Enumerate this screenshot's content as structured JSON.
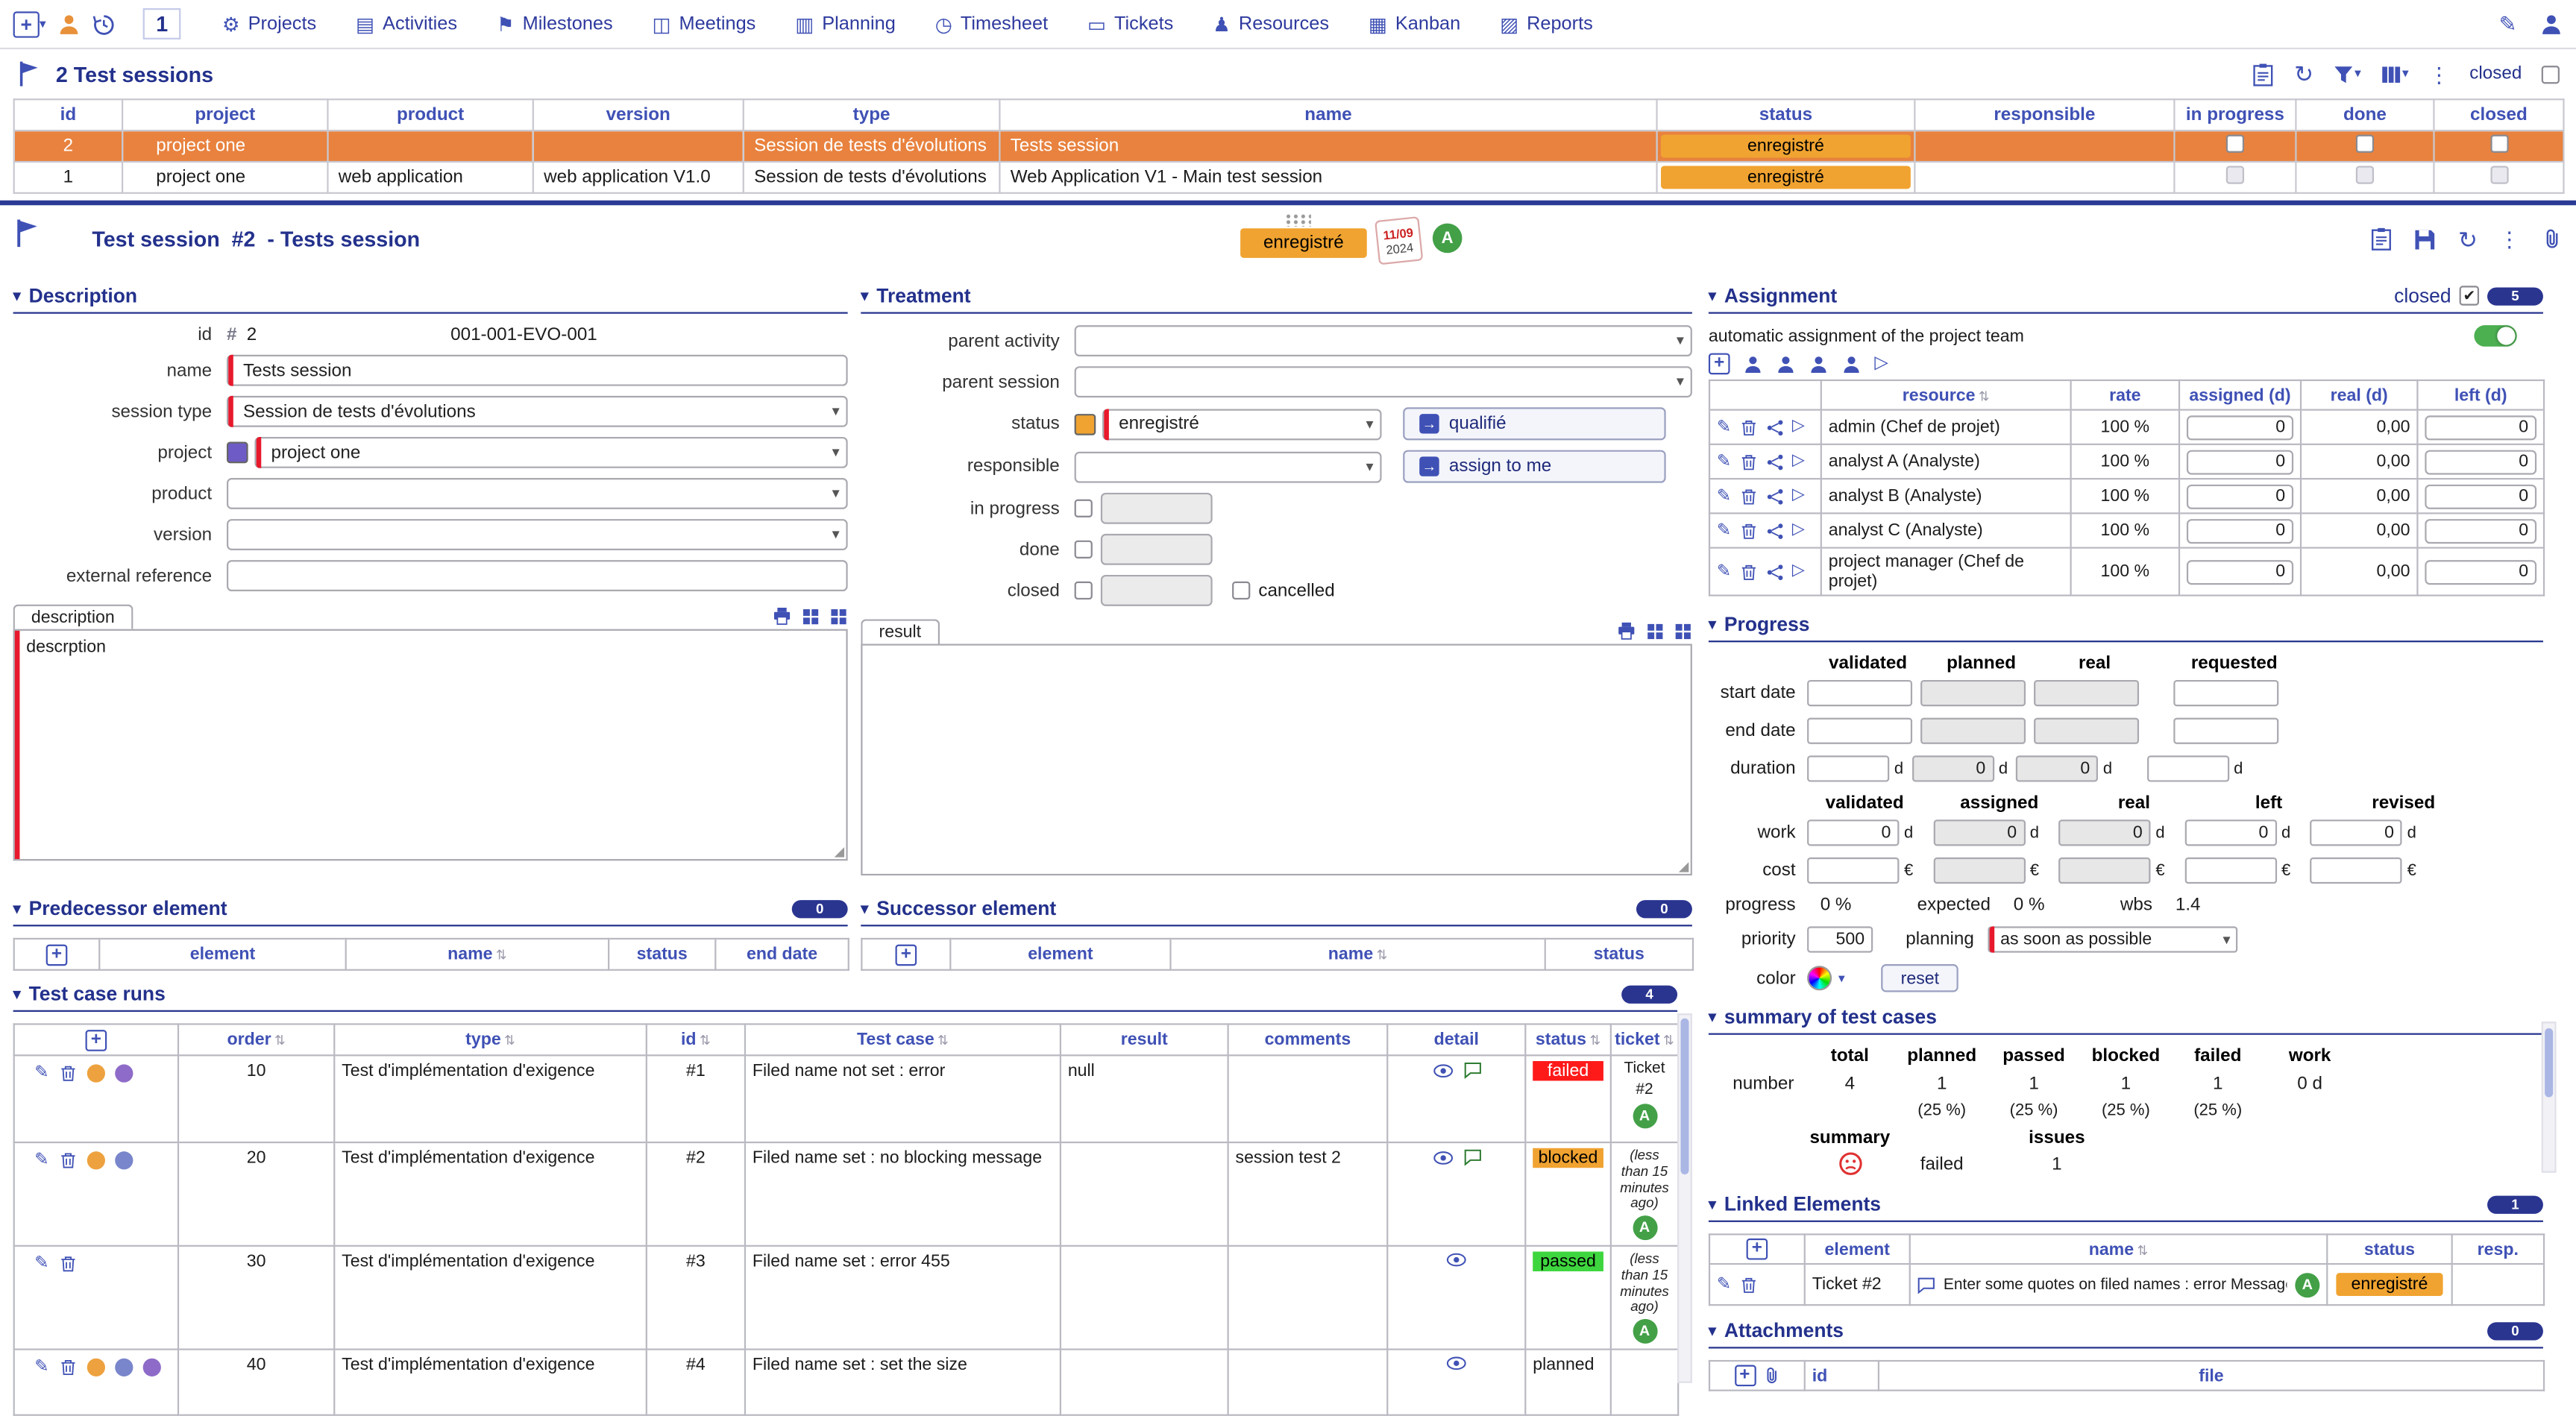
{
  "icons": {
    "plus": "+",
    "caret": "▾",
    "kebab": "⋮",
    "refresh": "↻",
    "pencil": "✎",
    "sort": "⇅",
    "play": "▷",
    "hash": "#",
    "check": "✔",
    "arrow": "→"
  },
  "status_colors": {
    "failed": {
      "bg": "#ff1a1a",
      "fg": "#ffffff"
    },
    "blocked": {
      "bg": "#f0a330",
      "fg": "#000000"
    },
    "passed": {
      "bg": "#3ed63e",
      "fg": "#000000"
    },
    "planned": {
      "bg": "#ffffff",
      "fg": "#000000"
    },
    "enregistré": {
      "bg": "#f0a330",
      "fg": "#000000"
    }
  },
  "topbar": {
    "count_badge": "1",
    "menu": [
      {
        "icon": "⚙",
        "label": "Projects"
      },
      {
        "icon": "▤",
        "label": "Activities"
      },
      {
        "icon": "⚑",
        "label": "Milestones"
      },
      {
        "icon": "◫",
        "label": "Meetings"
      },
      {
        "icon": "▥",
        "label": "Planning"
      },
      {
        "icon": "◷",
        "label": "Timesheet"
      },
      {
        "icon": "▭",
        "label": "Tickets"
      },
      {
        "icon": "♟",
        "label": "Resources"
      },
      {
        "icon": "▦",
        "label": "Kanban"
      },
      {
        "icon": "▨",
        "label": "Reports"
      }
    ]
  },
  "list": {
    "title": "2 Test sessions",
    "closed_label": "closed",
    "columns": {
      "id": "id",
      "project": "project",
      "product": "product",
      "version": "version",
      "type": "type",
      "name": "name",
      "status": "status",
      "responsible": "responsible",
      "in_progress": "in progress",
      "done": "done",
      "closed": "closed"
    },
    "rows": [
      {
        "id": "2",
        "project": "project one",
        "product": "",
        "version": "",
        "type": "Session de tests d'évolutions",
        "name": "Tests session",
        "status": "enregistré"
      },
      {
        "id": "1",
        "project": "project one",
        "product": "web application",
        "version": "web application V1.0",
        "type": "Session de tests d'évolutions",
        "name": "Web Application V1 - Main test session",
        "status": "enregistré"
      }
    ]
  },
  "detail": {
    "title": "Test session  #2  - Tests session",
    "status": "enregistré",
    "stamp_day": "11/09",
    "stamp_year": "2024",
    "avatar": "A"
  },
  "description": {
    "title": "Description",
    "labels": {
      "id": "id",
      "name": "name",
      "session_type": "session type",
      "project": "project",
      "product": "product",
      "version": "version",
      "external_reference": "external reference"
    },
    "id_value": "2",
    "code": "001-001-EVO-001",
    "name_value": "Tests session",
    "session_type_value": "Session de tests d'évolutions",
    "project_value": "project one",
    "tab": "description",
    "text": "descrption"
  },
  "treatment": {
    "title": "Treatment",
    "labels": {
      "parent_activity": "parent activity",
      "parent_session": "parent session",
      "status": "status",
      "responsible": "responsible",
      "in_progress": "in progress",
      "done": "done",
      "closed": "closed",
      "cancelled": "cancelled"
    },
    "status_value": "enregistré",
    "qualify_button": "qualifié",
    "assign_button": "assign to me",
    "tab": "result"
  },
  "predecessor": {
    "title": "Predecessor element",
    "badge": "0",
    "columns": [
      "element",
      "name",
      "status",
      "end date"
    ]
  },
  "successor": {
    "title": "Successor element",
    "badge": "0",
    "columns": [
      "element",
      "name",
      "status"
    ]
  },
  "test_runs": {
    "title": "Test case runs",
    "badge": "4",
    "columns": {
      "order": "order",
      "type": "type",
      "id": "id",
      "test_case": "Test case",
      "result": "result",
      "comments": "comments",
      "detail": "detail",
      "status": "status",
      "ticket": "ticket"
    },
    "rows": [
      {
        "order": "10",
        "type": "Test d'implémentation d'exigence",
        "id": "#1",
        "test_case": "Filed name not set : error",
        "result": "null",
        "comments": "",
        "status": "failed",
        "ticket_line1": "Ticket",
        "ticket_line2": "#2",
        "avatar": "A"
      },
      {
        "order": "20",
        "type": "Test d'implémentation d'exigence",
        "id": "#2",
        "test_case": "Filed name set : no blocking message",
        "result": "",
        "comments": "session test 2",
        "status": "blocked",
        "ticket_note": "(less than 15 minutes ago)",
        "avatar": "A"
      },
      {
        "order": "30",
        "type": "Test d'implémentation d'exigence",
        "id": "#3",
        "test_case": "Filed name set : error 455",
        "result": "",
        "comments": "",
        "status": "passed",
        "ticket_note": "(less than 15 minutes ago)",
        "avatar": "A"
      },
      {
        "order": "40",
        "type": "Test d'implémentation d'exigence",
        "id": "#4",
        "test_case": "Filed name set : set the size",
        "result": "",
        "comments": "",
        "status": "planned"
      }
    ]
  },
  "assignment": {
    "title": "Assignment",
    "closed_label": "closed",
    "badge": "5",
    "auto_label": "automatic assignment of the project team",
    "columns": {
      "resource": "resource",
      "rate": "rate",
      "assigned": "assigned (d)",
      "real": "real (d)",
      "left": "left (d)"
    },
    "rows": [
      {
        "resource": "admin (Chef de projet)",
        "rate": "100 %",
        "assigned": "0",
        "real": "0,00",
        "left": "0"
      },
      {
        "resource": "analyst A (Analyste)",
        "rate": "100 %",
        "assigned": "0",
        "real": "0,00",
        "left": "0"
      },
      {
        "resource": "analyst B (Analyste)",
        "rate": "100 %",
        "assigned": "0",
        "real": "0,00",
        "left": "0"
      },
      {
        "resource": "analyst C (Analyste)",
        "rate": "100 %",
        "assigned": "0",
        "real": "0,00",
        "left": "0"
      },
      {
        "resource": "project manager (Chef de projet)",
        "rate": "100 %",
        "assigned": "0",
        "real": "0,00",
        "left": "0"
      }
    ]
  },
  "progress": {
    "title": "Progress",
    "head1": [
      "validated",
      "planned",
      "real",
      "requested"
    ],
    "labels": {
      "start_date": "start date",
      "end_date": "end date",
      "duration": "duration",
      "work": "work",
      "cost": "cost",
      "progress": "progress",
      "priority": "priority",
      "color": "color"
    },
    "duration_planned": "0",
    "duration_real": "0",
    "unit_day": "d",
    "unit_eur": "€",
    "head2": [
      "validated",
      "assigned",
      "real",
      "left",
      "revised"
    ],
    "work_values": [
      "0",
      "0",
      "0",
      "0",
      "0"
    ],
    "progress_value": "0 %",
    "expected_label": "expected",
    "expected_value": "0 %",
    "wbs_label": "wbs",
    "wbs_value": "1.4",
    "priority_value": "500",
    "planning_label": "planning",
    "planning_value": "as soon as possible",
    "reset_button": "reset"
  },
  "summary": {
    "title": "summary of test cases",
    "headers": [
      "total",
      "planned",
      "passed",
      "blocked",
      "failed",
      "work"
    ],
    "number_label": "number",
    "values": [
      "4",
      "1",
      "1",
      "1",
      "1",
      "0 d"
    ],
    "percents": [
      "(25 %)",
      "(25 %)",
      "(25 %)",
      "(25 %)"
    ],
    "summary_label": "summary",
    "failed_text": "failed",
    "issues_label": "issues",
    "issues_value": "1"
  },
  "linked": {
    "title": "Linked Elements",
    "badge": "1",
    "columns": {
      "element": "element",
      "name": "name",
      "status": "status",
      "resp": "resp."
    },
    "rows": [
      {
        "element": "Ticket #2",
        "name": "Enter some quotes on filed names : error Message",
        "status": "enregistré",
        "avatar": "A"
      }
    ]
  },
  "attachments": {
    "title": "Attachments",
    "badge": "0",
    "id_label": "id",
    "file_label": "file"
  }
}
